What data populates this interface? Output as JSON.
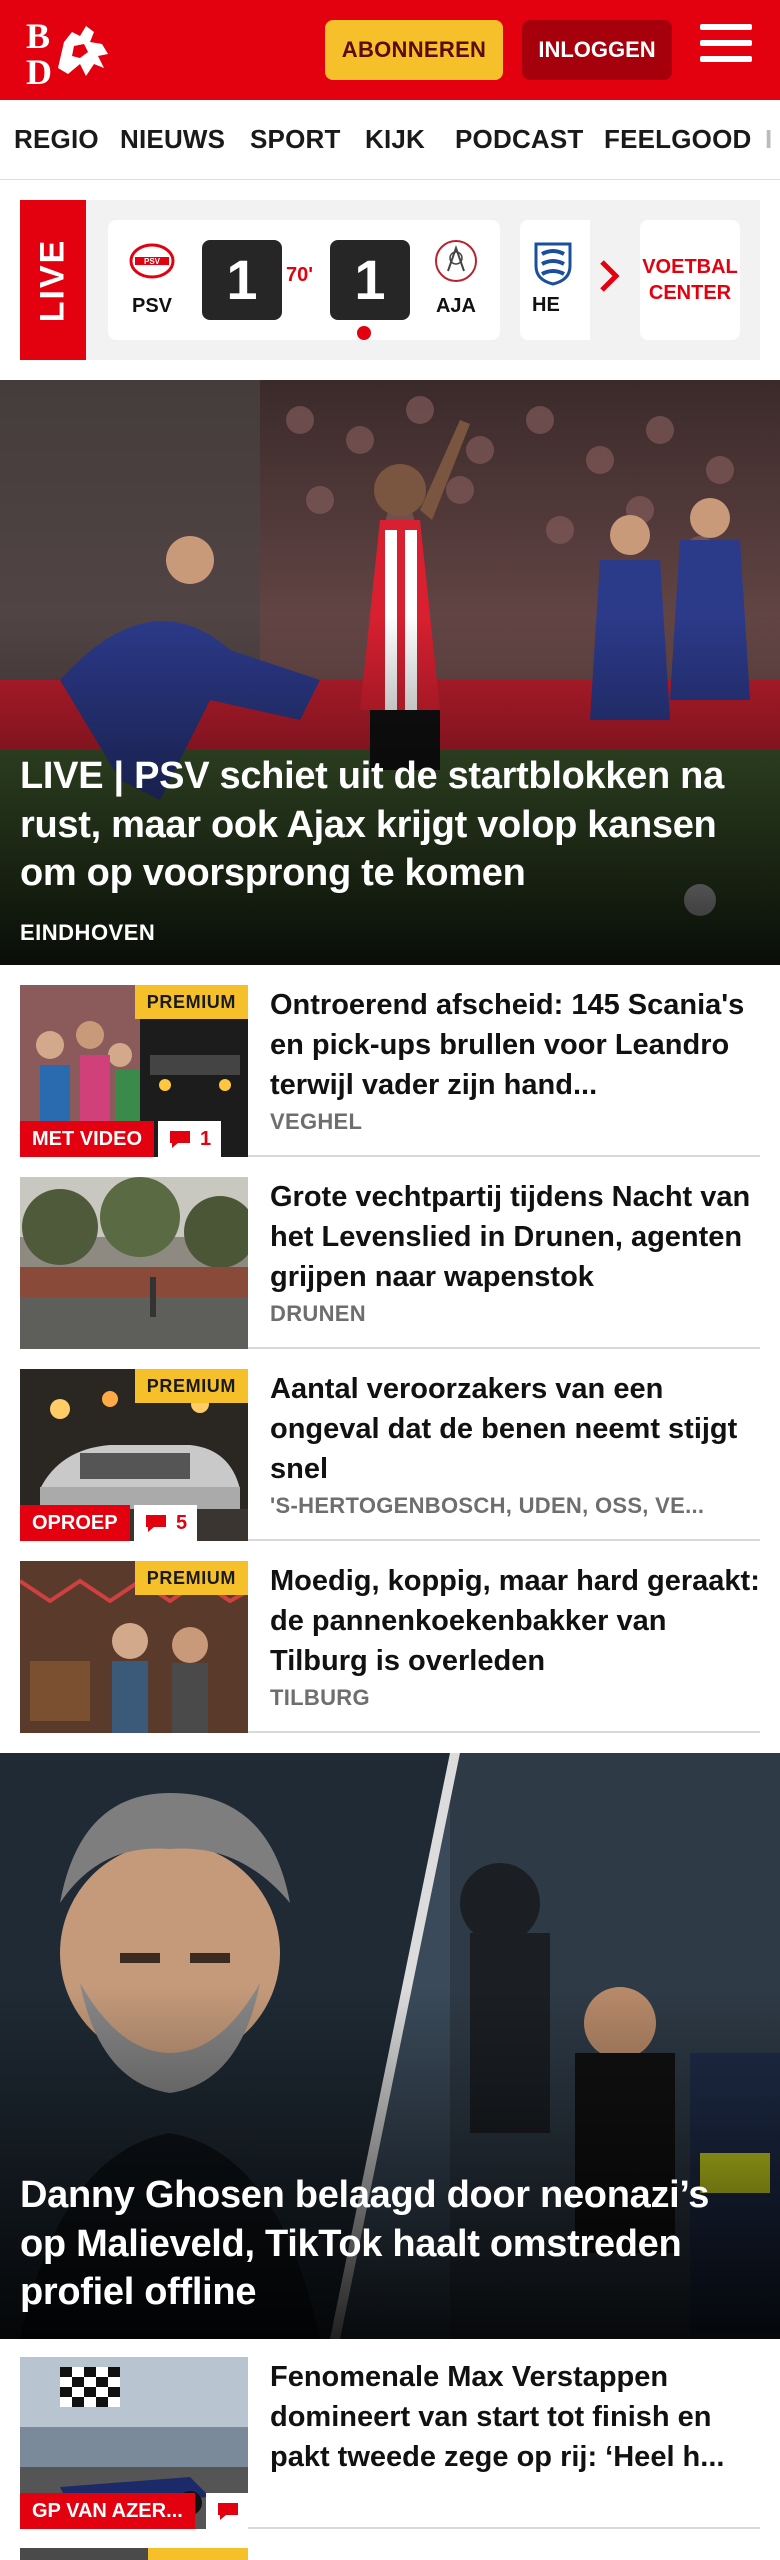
{
  "header": {
    "logo_text": "BD",
    "subscribe_label": "ABONNEREN",
    "login_label": "INLOGGEN"
  },
  "nav": {
    "items": [
      "REGIO",
      "NIEUWS",
      "SPORT",
      "KIJK",
      "PODCAST",
      "FEELGOOD"
    ]
  },
  "live": {
    "tag": "LIVE",
    "match": {
      "home": "PSV",
      "away": "AJA",
      "home_score": "1",
      "away_score": "1",
      "minute": "70'"
    },
    "next_match_home": "HE",
    "voetbal_center": "VOETBAL CENTER"
  },
  "hero1": {
    "title": "LIVE | PSV schiet uit de startblokken na rust, maar ook Ajax krijgt volop kansen om op voorsprong te komen",
    "location": "EINDHOVEN"
  },
  "articles": [
    {
      "title": "Ontroerend afscheid: 145 Scania's en pick-ups brullen voor Leandro terwijl vader zijn hand...",
      "location": "VEGHEL",
      "premium": "PREMIUM",
      "label": "MET VIDEO",
      "comments": "1"
    },
    {
      "title": "Grote vechtpartij tijdens Nacht van het Levenslied in Drunen, agenten grijpen naar wapenstok",
      "location": "DRUNEN"
    },
    {
      "title": "Aantal veroorzakers van een ongeval dat de benen neemt stijgt snel",
      "location": "'S-HERTOGENBOSCH, UDEN, OSS, VE...",
      "premium": "PREMIUM",
      "label": "OPROEP",
      "comments": "5"
    },
    {
      "title": "Moedig, koppig, maar hard geraakt: de pannenkoekenbakker van Tilburg is overleden",
      "location": "TILBURG",
      "premium": "PREMIUM"
    }
  ],
  "hero2": {
    "title": "Danny Ghosen belaagd door neonazi’s op Malieveld, TikTok haalt omstreden profiel offline"
  },
  "articles2": [
    {
      "title": "Fenomenale Max Verstappen domineert van start tot finish en pakt tweede zege op rij: ‘Heel h...",
      "label": "GP VAN AZER..."
    }
  ],
  "colors": {
    "brand_red": "#e3000f",
    "accent_yellow": "#f6c02b",
    "dark_red": "#a5000c"
  }
}
